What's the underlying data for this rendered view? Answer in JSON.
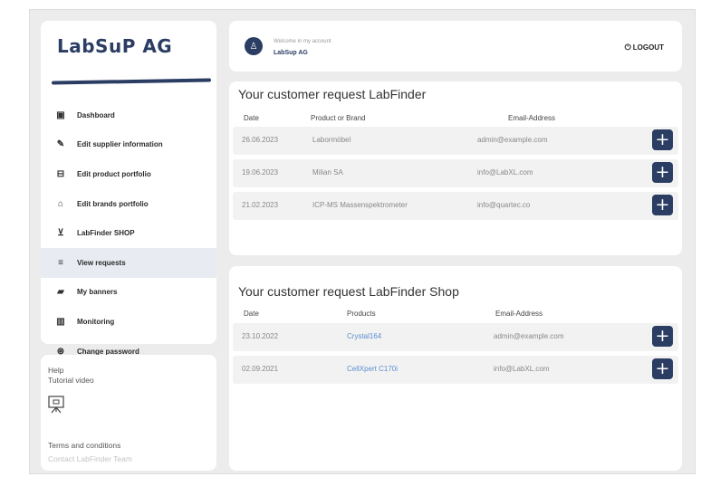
{
  "logo": "LabSuP AG",
  "menu": [
    {
      "icon": "dashboard-icon",
      "glyph": "▣",
      "label": "Dashboard"
    },
    {
      "icon": "edit-supplier-icon",
      "glyph": "✎",
      "label": "Edit supplier information"
    },
    {
      "icon": "product-icon",
      "glyph": "⊟",
      "label": "Edit product portfolio"
    },
    {
      "icon": "tag-icon",
      "glyph": "⌂",
      "label": "Edit brands portfolio"
    },
    {
      "icon": "cart-icon",
      "glyph": "⊻",
      "label": "LabFinder SHOP"
    },
    {
      "icon": "requests-icon",
      "glyph": "≡",
      "label": "View requests"
    },
    {
      "icon": "banner-icon",
      "glyph": "▰",
      "label": "My banners"
    },
    {
      "icon": "monitoring-icon",
      "glyph": "▥",
      "label": "Monitoring"
    },
    {
      "icon": "password-icon",
      "glyph": "⊛",
      "label": "Change password"
    }
  ],
  "side2": {
    "help": "Help",
    "tutorial": "Tutorial video",
    "terms": "Terms and conditions",
    "contact": "Contact LabFinder Team"
  },
  "header": {
    "welcome": "Welcome in my account",
    "account": "LabSup AG",
    "logout": "LOGOUT"
  },
  "requests": {
    "title": "Your customer request LabFinder",
    "headers": [
      "Date",
      "Product or Brand",
      "Email-Address"
    ],
    "rows": [
      {
        "date": "26.06.2023",
        "product": "Labormöbel",
        "email": "admin@example.com"
      },
      {
        "date": "19.06.2023",
        "product": "Milian SA",
        "email": "info@LabXL.com"
      },
      {
        "date": "21.02.2023",
        "product": "ICP-MS Massenspektrometer",
        "email": "info@quartec.co"
      }
    ]
  },
  "shop": {
    "title": "Your customer request LabFinder Shop",
    "headers": [
      "Date",
      "Products",
      "Email-Address"
    ],
    "rows": [
      {
        "date": "23.10.2022",
        "product": "Crystal164",
        "email": "admin@example.com"
      },
      {
        "date": "02.09.2021",
        "product": "CellXpert C170i",
        "email": "info@LabXL.com"
      }
    ]
  },
  "colors": {
    "accent": "#2b3d63",
    "link": "#5b8fd1",
    "row": "#f2f2f2",
    "active": "#e8ebf1"
  }
}
